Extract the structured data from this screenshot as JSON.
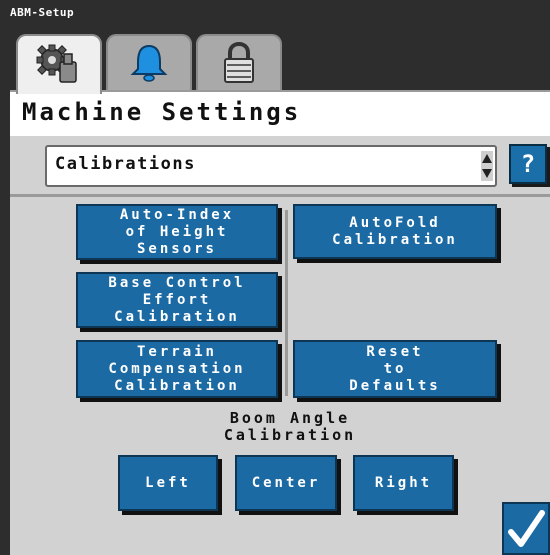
{
  "app": {
    "title": "ABM-Setup"
  },
  "tabs": [
    {
      "name": "settings",
      "icon": "gears-icon",
      "active": true
    },
    {
      "name": "alarms",
      "icon": "bell-icon",
      "active": false
    },
    {
      "name": "lock",
      "icon": "lock-icon",
      "active": false
    }
  ],
  "header": {
    "title": "Machine Settings"
  },
  "dropdown": {
    "value": "Calibrations"
  },
  "help": {
    "label": "?"
  },
  "buttons": {
    "auto_index": "Auto-Index\nof Height\nSensors",
    "autofold": "AutoFold\nCalibration",
    "base_control": "Base Control\nEffort\nCalibration",
    "terrain": "Terrain\nCompensation\nCalibration",
    "reset": "Reset\nto\nDefaults"
  },
  "boom_angle": {
    "label": "Boom Angle\nCalibration",
    "left": "Left",
    "center": "Center",
    "right": "Right"
  },
  "colors": {
    "button": "#1c6aa4",
    "panel": "#d2d2d2",
    "frame": "#2d2d2d"
  }
}
